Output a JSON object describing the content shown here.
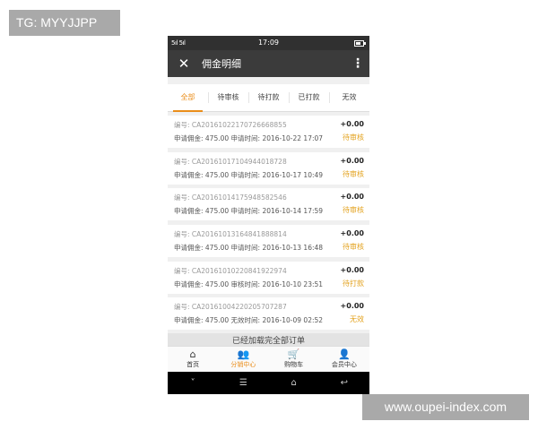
{
  "watermark_top": "TG: MYYJJPP",
  "watermark_bottom": "www.oupei-index.com",
  "status_bar": {
    "signal": "5ıl 5ıl",
    "time": "17:09"
  },
  "header": {
    "close_icon": "close-icon",
    "title": "佣金明细",
    "more_icon": "more-vertical-icon"
  },
  "tabs": [
    "全部",
    "待审核",
    "待打款",
    "已打款",
    "无效"
  ],
  "active_tab": 0,
  "records": [
    {
      "no": "编号: CA201610221707266688​55",
      "detail": "申请佣金: 475.00 申请时间: 2016-10-22 17:07",
      "amount": "+0.00",
      "status": "待审核"
    },
    {
      "no": "编号: CA20161017104944018728",
      "detail": "申请佣金: 475.00 申请时间: 2016-10-17 10:49",
      "amount": "+0.00",
      "status": "待审核"
    },
    {
      "no": "编号: CA20161014175948582546",
      "detail": "申请佣金: 475.00 申请时间: 2016-10-14 17:59",
      "amount": "+0.00",
      "status": "待审核"
    },
    {
      "no": "编号: CA20161013164841888814",
      "detail": "申请佣金: 475.00 申请时间: 2016-10-13 16:48",
      "amount": "+0.00",
      "status": "待审核"
    },
    {
      "no": "编号: CA20161010220841922974",
      "detail": "申请佣金: 475.00 审核时间: 2016-10-10 23:51",
      "amount": "+0.00",
      "status": "待打款"
    },
    {
      "no": "编号: CA20161004220205707287",
      "detail": "申请佣金: 475.00 无效时间: 2016-10-09 02:52",
      "amount": "+0.00",
      "status": "无效"
    }
  ],
  "loaded_text": "已经加载完全部订单",
  "bottom_nav": [
    {
      "icon": "home-icon",
      "label": "首页"
    },
    {
      "icon": "group-icon",
      "label": "分销中心"
    },
    {
      "icon": "cart-icon",
      "label": "购物车"
    },
    {
      "icon": "user-icon",
      "label": "会员中心"
    }
  ],
  "active_nav": 1,
  "system_buttons": [
    "chevron-down-icon",
    "menu-icon",
    "home-outline-icon",
    "back-icon"
  ],
  "colors": {
    "accent": "#ea8d1a",
    "status": "#e3a21e",
    "header_bg": "#3b3b3b"
  }
}
